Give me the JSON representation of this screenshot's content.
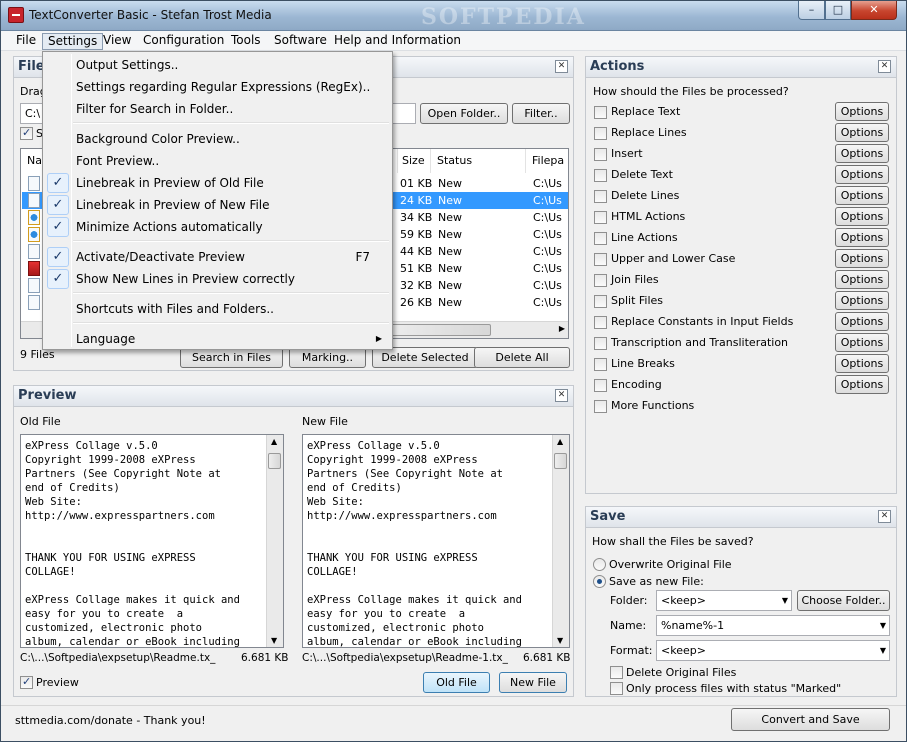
{
  "window": {
    "title": "TextConverter Basic - Stefan Trost Media",
    "watermark": "SOFTPEDIA",
    "min_glyph": "–",
    "max_glyph": "□",
    "close_glyph": "✕"
  },
  "menubar": [
    "File",
    "Settings",
    "View",
    "Configuration",
    "Tools",
    "Software",
    "Help and Information"
  ],
  "settings_menu": [
    {
      "label": "Output Settings..",
      "checked": false
    },
    {
      "label": "Settings regarding Regular Expressions (RegEx)..",
      "checked": false
    },
    {
      "label": "Filter for Search in Folder..",
      "checked": false
    },
    {
      "label": "Background Color Preview..",
      "checked": false
    },
    {
      "label": "Font Preview..",
      "checked": false
    },
    {
      "label": "Linebreak in Preview of Old File",
      "checked": true
    },
    {
      "label": "Linebreak in Preview of New File",
      "checked": true
    },
    {
      "label": "Minimize Actions automatically",
      "checked": true
    },
    {
      "label": "Activate/Deactivate Preview",
      "checked": true,
      "shortcut": "F7"
    },
    {
      "label": "Show New Lines in Preview correctly",
      "checked": true
    },
    {
      "label": "Shortcuts with Files and Folders..",
      "checked": false
    },
    {
      "label": "Language",
      "checked": false,
      "submenu": true
    }
  ],
  "files_panel": {
    "title_partial": "File",
    "drag_partial": "Drag",
    "path_partial": "C:\\",
    "s_partial": "S",
    "open_folder": "Open Folder..",
    "filter": "Filter..",
    "columns": {
      "name_partial": "Na",
      "size": "Size",
      "status": "Status",
      "filepath_partial": "Filepa"
    },
    "rows": [
      {
        "size": "01 KB",
        "status": "New",
        "path": "C:\\Us",
        "icon": "doc"
      },
      {
        "size": "24 KB",
        "status": "New",
        "path": "C:\\Us",
        "icon": "doc",
        "selected": true
      },
      {
        "size": "34 KB",
        "status": "New",
        "path": "C:\\Us",
        "icon": "ie"
      },
      {
        "size": "59 KB",
        "status": "New",
        "path": "C:\\Us",
        "icon": "ie"
      },
      {
        "size": "44 KB",
        "status": "New",
        "path": "C:\\Us",
        "icon": "doc"
      },
      {
        "size": "51 KB",
        "status": "New",
        "path": "C:\\Us",
        "icon": "pdf"
      },
      {
        "size": "32 KB",
        "status": "New",
        "path": "C:\\Us",
        "icon": "doc"
      },
      {
        "size": "26 KB",
        "status": "New",
        "path": "C:\\Us",
        "icon": "doc"
      }
    ],
    "count": "9 Files",
    "search_in_files": "Search in Files",
    "marking": "Marking..",
    "delete_selected": "Delete Selected",
    "delete_all": "Delete All"
  },
  "preview": {
    "title": "Preview",
    "old_label": "Old File",
    "new_label": "New File",
    "old_text": "eXPress Collage v.5.0\nCopyright 1999-2008 eXPress\nPartners (See Copyright Note at\nend of Credits)\nWeb Site:\nhttp://www.expresspartners.com\n\n\nTHANK YOU FOR USING eXPRESS\nCOLLAGE!\n\neXPress Collage makes it quick and\neasy for you to create  a\ncustomized, electronic photo\nalbum, calendar or eBook including",
    "new_text": "eXPress Collage v.5.0\nCopyright 1999-2008 eXPress\nPartners (See Copyright Note at\nend of Credits)\nWeb Site:\nhttp://www.expresspartners.com\n\n\nTHANK YOU FOR USING eXPRESS\nCOLLAGE!\n\neXPress Collage makes it quick and\neasy for you to create  a\ncustomized, electronic photo\nalbum, calendar or eBook including",
    "old_path": "C:\\...\\Softpedia\\expsetup\\Readme.tx_",
    "old_size": "6.681 KB",
    "new_path": "C:\\...\\Softpedia\\expsetup\\Readme-1.tx_",
    "new_size": "6.681 KB",
    "preview_check": "Preview",
    "old_file_btn": "Old File",
    "new_file_btn": "New File"
  },
  "actions": {
    "title": "Actions",
    "question": "How should the Files be processed?",
    "option_label": "Options",
    "items": [
      {
        "label": "Replace Text",
        "has_options": true
      },
      {
        "label": "Replace Lines",
        "has_options": true
      },
      {
        "label": "Insert",
        "has_options": true
      },
      {
        "label": "Delete Text",
        "has_options": true
      },
      {
        "label": "Delete Lines",
        "has_options": true
      },
      {
        "label": "HTML Actions",
        "has_options": true
      },
      {
        "label": "Line Actions",
        "has_options": true
      },
      {
        "label": "Upper and Lower Case",
        "has_options": true
      },
      {
        "label": "Join Files",
        "has_options": true
      },
      {
        "label": "Split Files",
        "has_options": true
      },
      {
        "label": "Replace Constants in Input Fields",
        "has_options": true
      },
      {
        "label": "Transcription and Transliteration",
        "has_options": true
      },
      {
        "label": "Line Breaks",
        "has_options": true
      },
      {
        "label": "Encoding",
        "has_options": true
      },
      {
        "label": "More Functions",
        "has_options": false
      }
    ]
  },
  "save": {
    "title": "Save",
    "question": "How shall the Files be saved?",
    "overwrite": "Overwrite Original File",
    "save_new": "Save as new File:",
    "folder_label": "Folder:",
    "folder_value": "<keep>",
    "choose_folder": "Choose Folder..",
    "name_label": "Name:",
    "name_value": "%name%-1",
    "format_label": "Format:",
    "format_value": "<keep>",
    "delete_original": "Delete Original Files",
    "only_marked": "Only process files with status \"Marked\""
  },
  "status": {
    "donate": "sttmedia.com/donate - Thank you!",
    "convert_save": "Convert and Save"
  },
  "icons": {
    "check_glyph": "✓",
    "submenu_arrow": "▶",
    "combo_arrow": "▼",
    "scroll_up": "▲",
    "scroll_down": "▼",
    "scroll_left": "◀",
    "scroll_right": "▶",
    "panel_close": "✕"
  },
  "colors": {
    "selection": "#3399ff",
    "close_button": "#c8452e",
    "panel_title": "#2a3d55"
  }
}
